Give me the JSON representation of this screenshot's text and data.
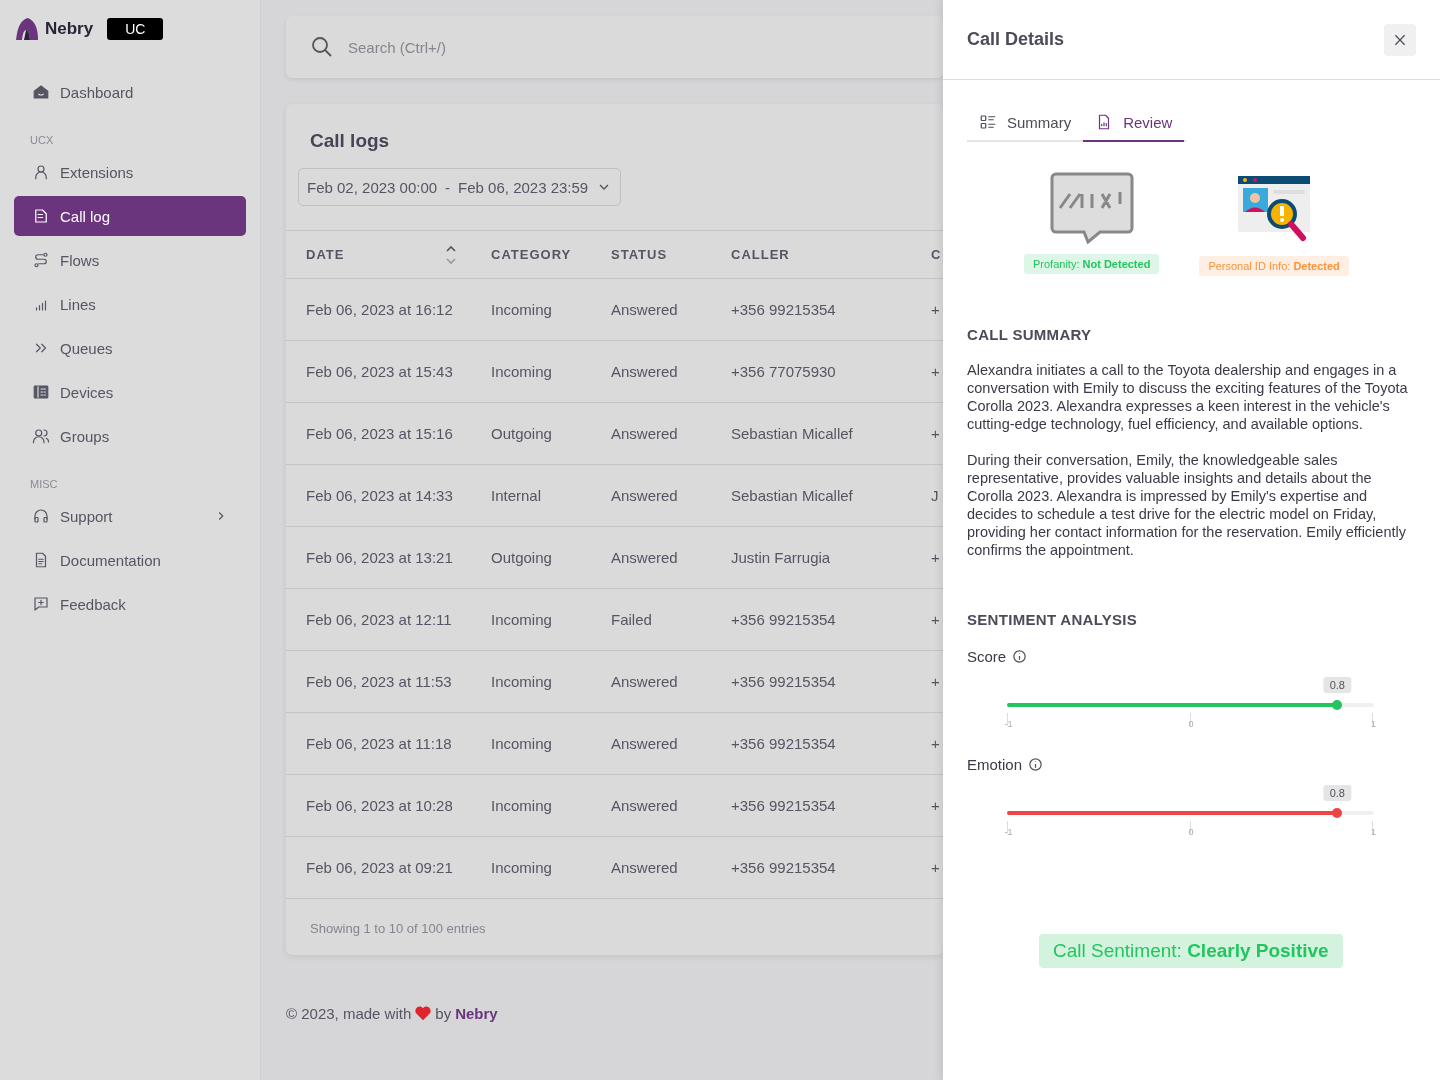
{
  "brand": {
    "name": "Nebry",
    "badge": "UC"
  },
  "sidebar": {
    "sections": [
      {
        "items": [
          {
            "label": "Dashboard",
            "selected": false,
            "chevron": false
          }
        ]
      },
      {
        "title": "UCX",
        "items": [
          {
            "label": "Extensions",
            "selected": false,
            "chevron": false
          },
          {
            "label": "Call log",
            "selected": true,
            "chevron": false
          },
          {
            "label": "Flows",
            "selected": false,
            "chevron": false
          },
          {
            "label": "Lines",
            "selected": false,
            "chevron": false
          },
          {
            "label": "Queues",
            "selected": false,
            "chevron": false
          },
          {
            "label": "Devices",
            "selected": false,
            "chevron": false
          },
          {
            "label": "Groups",
            "selected": false,
            "chevron": false
          }
        ]
      },
      {
        "title": "MISC",
        "items": [
          {
            "label": "Support",
            "selected": false,
            "chevron": true
          },
          {
            "label": "Documentation",
            "selected": false,
            "chevron": false
          },
          {
            "label": "Feedback",
            "selected": false,
            "chevron": false
          }
        ]
      }
    ]
  },
  "search": {
    "placeholder": "Search (Ctrl+/)"
  },
  "card": {
    "title": "Call logs",
    "date_range": {
      "from": "Feb 02, 2023 00:00",
      "separator": "-",
      "to": "Feb 06, 2023 23:59"
    }
  },
  "table": {
    "columns": [
      "DATE",
      "CATEGORY",
      "STATUS",
      "CALLER",
      "C"
    ],
    "rows": [
      [
        "Feb 06, 2023 at 16:12",
        "Incoming",
        "Answered",
        "+356 99215354",
        "+"
      ],
      [
        "Feb 06, 2023 at 15:43",
        "Incoming",
        "Answered",
        "+356 77075930",
        "+"
      ],
      [
        "Feb 06, 2023 at 15:16",
        "Outgoing",
        "Answered",
        "Sebastian Micallef",
        "+"
      ],
      [
        "Feb 06, 2023 at 14:33",
        "Internal",
        "Answered",
        "Sebastian Micallef",
        "J"
      ],
      [
        "Feb 06, 2023 at 13:21",
        "Outgoing",
        "Answered",
        "Justin Farrugia",
        "+"
      ],
      [
        "Feb 06, 2023 at 12:11",
        "Incoming",
        "Failed",
        "+356 99215354",
        "+"
      ],
      [
        "Feb 06, 2023 at 11:53",
        "Incoming",
        "Answered",
        "+356 99215354",
        "+"
      ],
      [
        "Feb 06, 2023 at 11:18",
        "Incoming",
        "Answered",
        "+356 99215354",
        "+"
      ],
      [
        "Feb 06, 2023 at 10:28",
        "Incoming",
        "Answered",
        "+356 99215354",
        "+"
      ],
      [
        "Feb 06, 2023 at 09:21",
        "Incoming",
        "Answered",
        "+356 99215354",
        "+"
      ]
    ],
    "footer": "Showing 1 to 10 of 100 entries"
  },
  "page_footer": {
    "before": "© 2023, made with",
    "after": "by",
    "link": "Nebry"
  },
  "drawer": {
    "title": "Call Details",
    "tabs": [
      {
        "label": "Summary",
        "selected": false
      },
      {
        "label": "Review",
        "selected": true
      }
    ],
    "checks": [
      {
        "kind": "profanity",
        "label": "Profanity: **Not Detected**",
        "color": "#22c55e"
      },
      {
        "kind": "personal",
        "label": "Personal ID Info: **Detected**",
        "color": "#fb923c"
      }
    ],
    "summary_title": "CALL SUMMARY",
    "summary": [
      "Alexandra initiates a call to the Toyota dealership and engages in a conversation with Emily to discuss the exciting features of the Toyota Corolla 2023. Alexandra expresses a keen interest in the vehicle's cutting-edge technology, fuel efficiency, and available options.",
      "During their conversation, Emily, the knowledgeable sales representative, provides valuable insights and details about the Corolla 2023. Alexandra is impressed by Emily's expertise and decides to schedule a test drive for the electric model on Friday, providing her contact information for the reservation. Emily efficiently confirms the appointment."
    ],
    "sentiment_title": "SENTIMENT ANALYSIS",
    "sliders": [
      {
        "label": "Score",
        "value": "0.8",
        "level": 0.9,
        "color": "#22c55e",
        "ticks": [
          "-1",
          "0",
          "1"
        ]
      },
      {
        "label": "Emotion",
        "value": "0.8",
        "level": 0.9,
        "color": "#ef4444",
        "ticks": [
          "-1",
          "0",
          "1"
        ]
      }
    ],
    "verdict": "Call Sentiment: **Clearly Positive**"
  }
}
